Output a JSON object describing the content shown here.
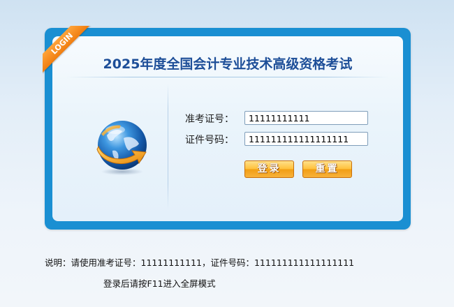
{
  "ribbon": {
    "label": "LOGIN"
  },
  "header": {
    "title": "2025年度全国会计专业技术高级资格考试"
  },
  "form": {
    "admission_label": "准考证号：",
    "admission_value": "11111111111",
    "id_label": "证件号码：",
    "id_value": "111111111111111111",
    "login_label": "登录",
    "reset_label": "重置"
  },
  "footer": {
    "line1": "说明：请使用准考证号：11111111111，证件号码：111111111111111111",
    "line2": "登录后请按F11进入全屏模式"
  },
  "colors": {
    "frame": "#1a8fd2",
    "title": "#1d4e98",
    "ribbon": "#f58a1f",
    "button": "#f7a825"
  },
  "icons": {
    "logo": "globe-arrow-icon"
  }
}
